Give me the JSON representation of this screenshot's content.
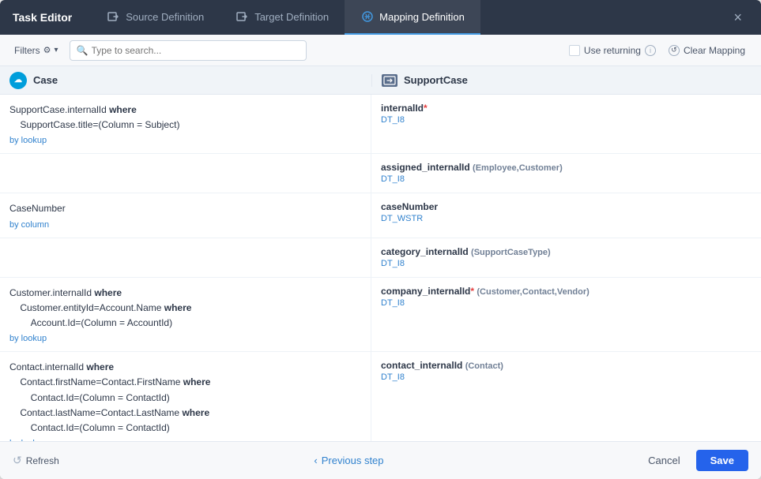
{
  "header": {
    "title": "Task Editor",
    "tabs": [
      {
        "id": "source",
        "label": "Source Definition",
        "active": false,
        "icon": "arrow-right-box"
      },
      {
        "id": "target",
        "label": "Target Definition",
        "active": false,
        "icon": "arrow-right-box"
      },
      {
        "id": "mapping",
        "label": "Mapping Definition",
        "active": true,
        "icon": "music-note"
      }
    ],
    "close_label": "×"
  },
  "toolbar": {
    "filters_label": "Filters",
    "search_placeholder": "Type to search...",
    "use_returning_label": "Use returning",
    "clear_mapping_label": "Clear Mapping"
  },
  "columns": {
    "source_label": "Case",
    "target_label": "SupportCase"
  },
  "rows": [
    {
      "source": "SupportCase.internalId where\n    SupportCase.title=(Column = Subject)",
      "source_badge": "by lookup",
      "target_field": "internalId*",
      "target_required": true,
      "target_type": "DT_I8",
      "target_sub": ""
    },
    {
      "source": "",
      "source_badge": "",
      "target_field": "assigned_internalId",
      "target_sub": "(Employee,Customer)",
      "target_type": "DT_I8"
    },
    {
      "source": "CaseNumber",
      "source_badge": "by column",
      "target_field": "caseNumber",
      "target_sub": "",
      "target_type": "DT_WSTR"
    },
    {
      "source": "",
      "source_badge": "",
      "target_field": "category_internalId",
      "target_sub": "(SupportCaseType)",
      "target_type": "DT_I8"
    },
    {
      "source": "Customer.internalId where\n    Customer.entityId=Account.Name where\n        Account.Id=(Column = AccountId)",
      "source_badge": "by lookup",
      "target_field": "company_internalId*",
      "target_required": true,
      "target_sub": "(Customer,Contact,Vendor)",
      "target_type": "DT_I8"
    },
    {
      "source": "Contact.internalId where\n    Contact.firstName=Contact.FirstName where\n        Contact.Id=(Column = ContactId)\n    Contact.lastName=Contact.LastName where\n        Contact.Id=(Column = ContactId)",
      "source_badge": "by lookup",
      "target_field": "contact_internalId",
      "target_sub": "(Contact)",
      "target_type": "DT_I8"
    }
  ],
  "footer": {
    "refresh_label": "Refresh",
    "prev_step_label": "Previous step",
    "cancel_label": "Cancel",
    "save_label": "Save"
  }
}
